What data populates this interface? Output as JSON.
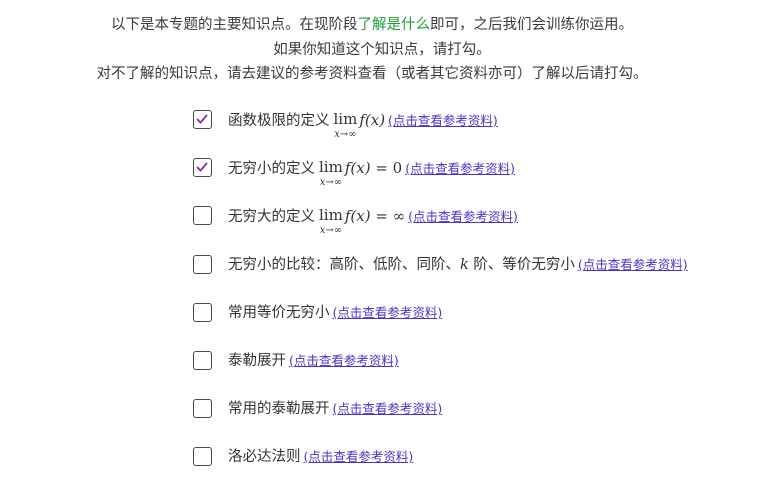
{
  "intro": {
    "line1_before": "以下是本专题的主要知识点。在现阶段",
    "line1_highlight": "了解是什么",
    "line1_after": "即可，之后我们会训练你运用。",
    "line2": "如果你知道这个知识点，请打勾。",
    "line3": "对不了解的知识点，请去建议的参考资料查看（或者其它资料亦可）了解以后请打勾。"
  },
  "colors": {
    "highlight": "#1f9d3a",
    "link": "#4a34c4",
    "check": "#8a2aa6"
  },
  "items": [
    {
      "label": "函数极限的定义",
      "math_lim": "lim",
      "math_sub": "x→∞",
      "math_f": "f(x)",
      "math_rest": "",
      "link": "(点击查看参考资料)",
      "checked": true
    },
    {
      "label": "无穷小的定义",
      "math_lim": "lim",
      "math_sub": "x→∞",
      "math_f": "f(x)",
      "math_rest": " = 0",
      "link": "(点击查看参考资料)",
      "checked": true
    },
    {
      "label": "无穷大的定义",
      "math_lim": "lim",
      "math_sub": "x→∞",
      "math_f": "f(x)",
      "math_rest": " = ∞",
      "link": "(点击查看参考资料)",
      "checked": false
    },
    {
      "label_before": "无穷小的比较：高阶、低阶、同阶、",
      "label_k": "k",
      "label_after": " 阶、等价无穷小",
      "link": "(点击查看参考资料)",
      "checked": false
    },
    {
      "label": "常用等价无穷小",
      "link": "(点击查看参考资料)",
      "checked": false
    },
    {
      "label": "泰勒展开",
      "link": "(点击查看参考资料)",
      "checked": false
    },
    {
      "label": "常用的泰勒展开",
      "link": "(点击查看参考资料)",
      "checked": false
    },
    {
      "label": "洛必达法则",
      "link": "(点击查看参考资料)",
      "checked": false
    }
  ]
}
